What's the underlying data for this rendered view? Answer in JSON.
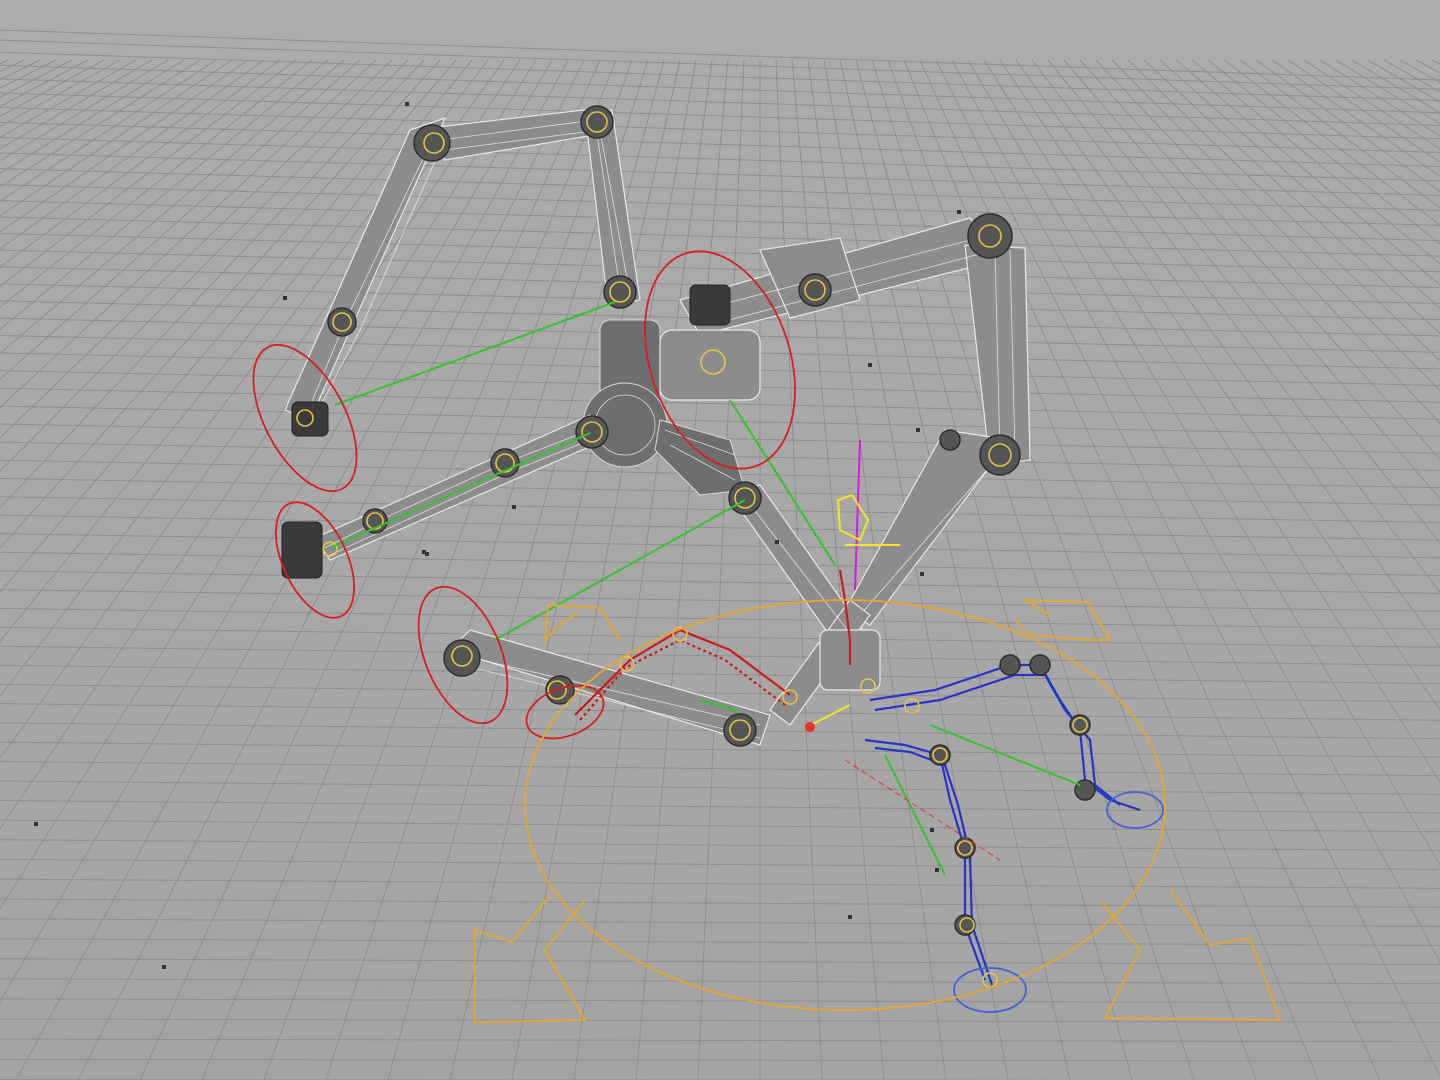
{
  "viewport": {
    "background": "#a8a8a8",
    "grid_color": "#8e8e8e",
    "limb_color": "#8c8c8c",
    "wire_color": "#f4f4f4",
    "joint_color": "#555555",
    "bone_ring_color": "#e6c24a",
    "ik_handle_color": "#d81e1e",
    "goal_line_color": "#35c42e",
    "left_leg_chain_color": "#cc1a1a",
    "right_leg_chain_color": "#2236c8",
    "move_gizmo_color": "#e7a72c",
    "up_axis_color": "#d21ee0",
    "y_axis_color": "#f1e42a",
    "x_axis_color": "#e33030",
    "foot_target_color": "#3f63d8"
  },
  "icons": {
    "move_gizmo": "move-arrows-icon",
    "axis": "transform-axis-icon"
  }
}
